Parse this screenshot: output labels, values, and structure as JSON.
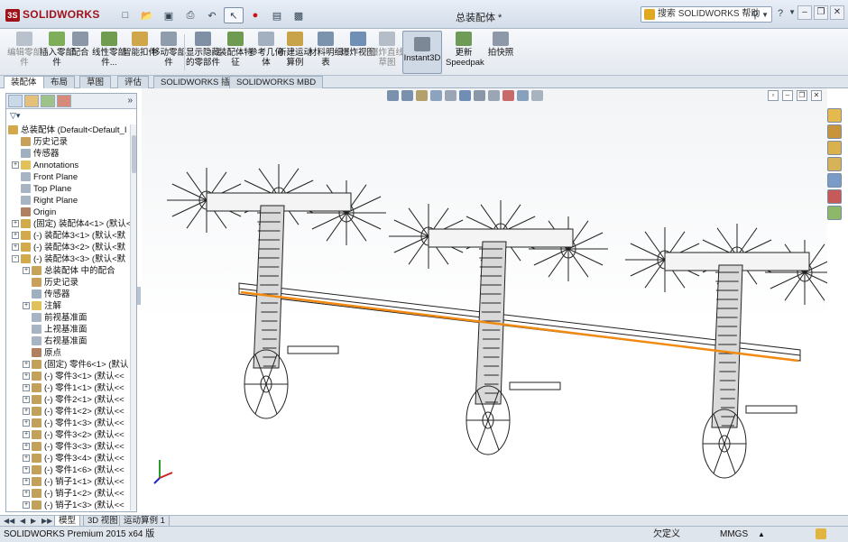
{
  "app": {
    "brand": "SOLIDWORKS",
    "doc_title": "总装配体 *"
  },
  "search": {
    "placeholder": "搜索 SOLIDWORKS 帮助"
  },
  "ribbon": {
    "buttons": [
      "编辑零部件",
      "插入零部件",
      "配合",
      "线性零部件...",
      "智能扣件",
      "移动零部件",
      "显示隐藏的零部件",
      "装配体特征",
      "参考几何体",
      "新建运动算例",
      "材料明细表",
      "爆炸视图",
      "爆炸直线草图",
      "Instant3D",
      "更新Speedpak",
      "拍快照"
    ]
  },
  "command_tabs": [
    "装配体",
    "布局",
    "草图",
    "评估",
    "SOLIDWORKS 插件",
    "SOLIDWORKS MBD"
  ],
  "tree": {
    "root": "总装配体 (Default<Default_I",
    "items": [
      {
        "label": "历史记录",
        "level": 1,
        "exp": ""
      },
      {
        "label": "传感器",
        "level": 1,
        "exp": ""
      },
      {
        "label": "Annotations",
        "level": 1,
        "exp": "+"
      },
      {
        "label": "Front Plane",
        "level": 1,
        "exp": ""
      },
      {
        "label": "Top Plane",
        "level": 1,
        "exp": ""
      },
      {
        "label": "Right Plane",
        "level": 1,
        "exp": ""
      },
      {
        "label": "Origin",
        "level": 1,
        "exp": ""
      },
      {
        "label": "(固定) 装配体4<1> (默认<",
        "level": 1,
        "exp": "+"
      },
      {
        "label": "(-) 装配体3<1> (默认<默",
        "level": 1,
        "exp": "+"
      },
      {
        "label": "(-) 装配体3<2> (默认<默",
        "level": 1,
        "exp": "+"
      },
      {
        "label": "(-) 装配体3<3> (默认<默",
        "level": 1,
        "exp": "-"
      },
      {
        "label": "总装配体 中的配合",
        "level": 2,
        "exp": "+"
      },
      {
        "label": "历史记录",
        "level": 2,
        "exp": ""
      },
      {
        "label": "传感器",
        "level": 2,
        "exp": ""
      },
      {
        "label": "注解",
        "level": 2,
        "exp": "+"
      },
      {
        "label": "前视基准面",
        "level": 2,
        "exp": ""
      },
      {
        "label": "上视基准面",
        "level": 2,
        "exp": ""
      },
      {
        "label": "右视基准面",
        "level": 2,
        "exp": ""
      },
      {
        "label": "原点",
        "level": 2,
        "exp": ""
      },
      {
        "label": "(固定) 零件6<1> (默认",
        "level": 2,
        "exp": "+"
      },
      {
        "label": "(-) 零件3<1> (默认<<",
        "level": 2,
        "exp": "+"
      },
      {
        "label": "(-) 零件1<1> (默认<<",
        "level": 2,
        "exp": "+"
      },
      {
        "label": "(-) 零件2<1> (默认<<",
        "level": 2,
        "exp": "+"
      },
      {
        "label": "(-) 零件1<2> (默认<<",
        "level": 2,
        "exp": "+"
      },
      {
        "label": "(-) 零件1<3> (默认<<",
        "level": 2,
        "exp": "+"
      },
      {
        "label": "(-) 零件3<2> (默认<<",
        "level": 2,
        "exp": "+"
      },
      {
        "label": "(-) 零件3<3> (默认<<",
        "level": 2,
        "exp": "+"
      },
      {
        "label": "(-) 零件3<4> (默认<<",
        "level": 2,
        "exp": "+"
      },
      {
        "label": "(-) 零件1<6> (默认<<",
        "level": 2,
        "exp": "+"
      },
      {
        "label": "(-) 销子1<1> (默认<<",
        "level": 2,
        "exp": "+"
      },
      {
        "label": "(-) 销子1<2> (默认<<",
        "level": 2,
        "exp": "+"
      },
      {
        "label": "(-) 销子1<3> (默认<<",
        "level": 2,
        "exp": "+"
      }
    ]
  },
  "bottom_tabs": [
    "模型",
    "3D 视图",
    "运动算例 1"
  ],
  "status": {
    "left": "SOLIDWORKS Premium 2015 x64 版",
    "mid": "欠定义",
    "units": "MMGS"
  },
  "colors": {
    "highlight_line": "#f28a12",
    "brand": "#a0121a"
  }
}
